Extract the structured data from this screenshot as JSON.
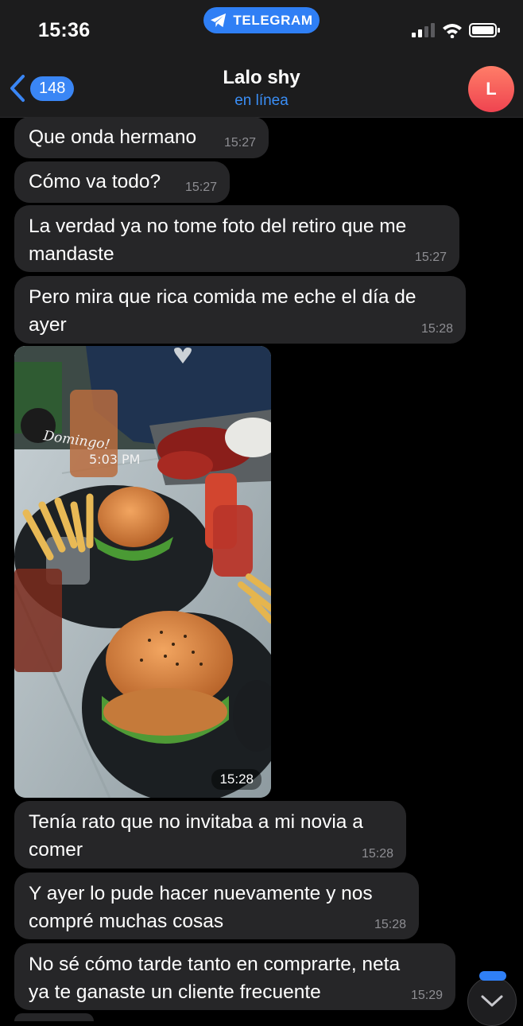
{
  "status_bar": {
    "time": "15:36",
    "banner": "TELEGRAM",
    "banner_color": "#2f7ff5"
  },
  "header": {
    "back_count": "148",
    "title": "Lalo shy",
    "subtitle": "en línea",
    "avatar_initial": "L",
    "accent_color": "#3a8ef6"
  },
  "messages": [
    {
      "lines": [
        "Que onda hermano"
      ],
      "time": "15:27"
    },
    {
      "lines": [
        "Cómo va todo?"
      ],
      "time": "15:27"
    },
    {
      "lines": [
        "La verdad ya no tome foto del retiro que me",
        "mandaste"
      ],
      "time": "15:27"
    },
    {
      "lines": [
        "Pero mira que rica comida me eche el día de",
        "ayer"
      ],
      "time": "15:28"
    },
    {
      "photo": {
        "overlay_line1": "Domingo!",
        "overlay_line2": "5:03 PM"
      },
      "time": "15:28"
    },
    {
      "lines": [
        "Tenía rato que no invitaba a mi novia a",
        "comer"
      ],
      "time": "15:28"
    },
    {
      "lines": [
        "Y ayer lo pude hacer nuevamente y nos",
        "compré muchas cosas"
      ],
      "time": "15:28"
    },
    {
      "lines": [
        "No sé cómo tarde tanto en comprarte, neta",
        "ya te ganaste un cliente frecuente"
      ],
      "time": "15:29"
    }
  ],
  "icons": {
    "back": "chevron-left-icon",
    "telegram": "paper-plane-icon",
    "signal": "signal-bars-icon",
    "wifi": "wifi-icon",
    "battery": "battery-icon",
    "scroll_down": "chevron-down-icon"
  }
}
